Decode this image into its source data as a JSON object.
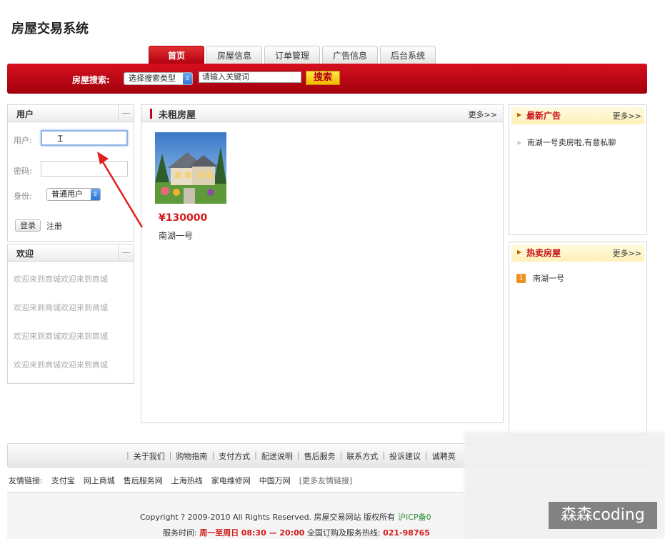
{
  "site": {
    "title": "房屋交易系统"
  },
  "tabs": [
    "首页",
    "房屋信息",
    "订单管理",
    "广告信息",
    "后台系统"
  ],
  "search": {
    "label": "房屋搜索:",
    "type_select": "选择搜索类型",
    "placeholder": "请输入关键词",
    "button": "搜索"
  },
  "user_panel": {
    "title": "用户",
    "collapse": "—",
    "username_label": "用户:",
    "password_label": "密码:",
    "role_label": "身份:",
    "role_value": "普通用户",
    "login_button": "登录",
    "register_link": "注册"
  },
  "welcome_panel": {
    "title": "欢迎",
    "collapse": "—",
    "lines": [
      "欢迎来到商城欢迎来到商城",
      "欢迎来到商城欢迎来到商城",
      "欢迎来到商城欢迎来到商城",
      "欢迎来到商城欢迎来到商城"
    ]
  },
  "main": {
    "title": "未租房屋",
    "more": "更多>>",
    "houses": [
      {
        "price": "¥130000",
        "name": "南湖一号"
      }
    ]
  },
  "ads": {
    "title": "最新广告",
    "more": "更多>>",
    "items": [
      "南湖一号卖房啦,有意私聊"
    ]
  },
  "hot": {
    "title": "热卖房屋",
    "more": "更多>>",
    "items": [
      {
        "rank": "1",
        "name": "南湖一号"
      }
    ]
  },
  "footer": {
    "links": [
      "关于我们",
      "购物指南",
      "支付方式",
      "配送说明",
      "售后服务",
      "联系方式",
      "投诉建议",
      "诚聘英"
    ],
    "friend_label": "友情链接:",
    "friends": [
      "支付宝",
      "网上商城",
      "售后服务网",
      "上海热线",
      "家电维修网",
      "中国万网"
    ],
    "friends_more": "[更多友情链接]",
    "copyright": "Copyright ? 2009-2010 All Rights Reserved. 房屋交易网站 版权所有",
    "icp": "沪ICP备0",
    "service_label": "服务时间:",
    "service_days": "周一至周日",
    "service_hours": "08:30 — 20:00",
    "hotline_label": "全国订购及服务热线:",
    "hotline": "021-98765"
  },
  "watermark": "森森coding",
  "colors": {
    "brand_red": "#c8001a",
    "price_red": "#d41a1a",
    "search_button": "#f5b800"
  }
}
